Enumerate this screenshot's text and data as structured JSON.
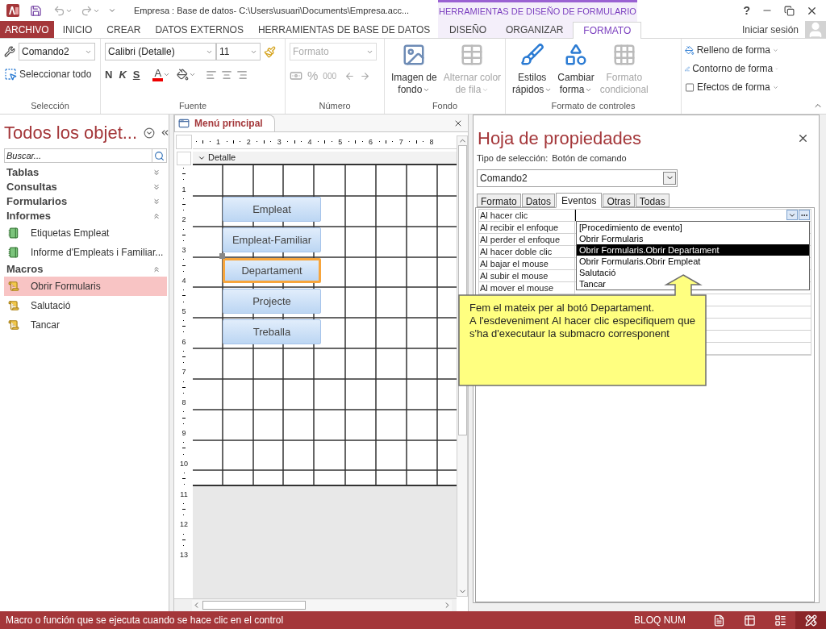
{
  "title_bar": {
    "title": "Empresa : Base de datos- C:\\Users\\usuari\\Documents\\Empresa.acc...",
    "contextual_group": "HERRAMIENTAS DE DISEÑO DE FORMULARIO",
    "help": "?"
  },
  "ribbon_tabs": [
    {
      "label": "ARCHIVO",
      "kind": "file",
      "selected": false
    },
    {
      "label": "INICIO",
      "kind": "normal",
      "selected": false
    },
    {
      "label": "CREAR",
      "kind": "normal",
      "selected": false
    },
    {
      "label": "DATOS EXTERNOS",
      "kind": "normal",
      "selected": false
    },
    {
      "label": "HERRAMIENTAS DE BASE DE DATOS",
      "kind": "normal",
      "selected": false
    },
    {
      "label": "DISEÑO",
      "kind": "contextual",
      "selected": false
    },
    {
      "label": "ORGANIZAR",
      "kind": "contextual",
      "selected": false
    },
    {
      "label": "FORMATO",
      "kind": "contextual",
      "selected": true
    }
  ],
  "account": {
    "sign_in": "Iniciar sesión"
  },
  "ribbon": {
    "seleccion": {
      "label": "Selección",
      "object_dropdown": "Comando2",
      "select_all": "Seleccionar todo"
    },
    "fuente": {
      "label": "Fuente",
      "font": "Calibri (Detalle)",
      "size": "11",
      "bold": "N",
      "italic": "K",
      "underline": "S",
      "font_color": "A"
    },
    "numero": {
      "label": "Número",
      "disabled": true,
      "format_dropdown": "Formato",
      "percent": "%",
      "thousands": "000"
    },
    "fondo": {
      "label": "Fondo",
      "buttons": [
        {
          "lines": [
            "Imagen de",
            "fondo"
          ],
          "kind": "picture",
          "disabled": false,
          "has_menu": true
        },
        {
          "lines": [
            "Alternar color",
            "de fila"
          ],
          "kind": "rows",
          "disabled": true,
          "has_menu": true
        }
      ]
    },
    "formato_controles": {
      "label": "Formato de controles",
      "large_buttons": [
        {
          "lines": [
            "Estilos",
            "rápidos"
          ],
          "kind": "styles",
          "disabled": false,
          "has_menu": true
        },
        {
          "lines": [
            "Cambiar",
            "forma"
          ],
          "kind": "shape",
          "disabled": false,
          "has_menu": true
        },
        {
          "lines": [
            "Formato",
            "condicional"
          ],
          "kind": "conditional",
          "disabled": true,
          "has_menu": false
        }
      ],
      "small_buttons": [
        {
          "label": "Relleno de forma",
          "kind": "fill"
        },
        {
          "label": "Contorno de forma",
          "kind": "outline"
        },
        {
          "label": "Efectos de forma",
          "kind": "effects"
        }
      ]
    }
  },
  "nav_pane": {
    "title": "Todos los objet...",
    "search_placeholder": "Buscar...",
    "groups": [
      {
        "label": "Tablas",
        "expanded": false
      },
      {
        "label": "Consultas",
        "expanded": false
      },
      {
        "label": "Formularios",
        "expanded": false
      },
      {
        "label": "Informes",
        "expanded": true,
        "children": [
          {
            "label": "Etiquetas Empleat",
            "kind": "report",
            "selected": false
          },
          {
            "label": "Informe d'Empleats i Familiar...",
            "kind": "report",
            "selected": false
          }
        ]
      },
      {
        "label": "Macros",
        "expanded": true,
        "children": [
          {
            "label": "Obrir Formularis",
            "kind": "macro",
            "selected": true
          },
          {
            "label": "Salutació",
            "kind": "macro",
            "selected": false
          },
          {
            "label": "Tancar",
            "kind": "macro",
            "selected": false
          }
        ]
      }
    ]
  },
  "document": {
    "tab": "Menú principal",
    "ruler_h": [
      "1",
      "2",
      "3",
      "4",
      "5",
      "6",
      "7",
      "8"
    ],
    "ruler_v": [
      "1",
      "2",
      "3",
      "4",
      "5",
      "6",
      "7",
      "8",
      "9",
      "10",
      "11",
      "12",
      "13"
    ],
    "section": "Detalle",
    "controls": [
      {
        "label": "Empleat",
        "selected": false
      },
      {
        "label": "Empleat-Familiar",
        "selected": false
      },
      {
        "label": "Departament",
        "selected": true
      },
      {
        "label": "Projecte",
        "selected": false
      },
      {
        "label": "Treballa",
        "selected": false
      }
    ]
  },
  "property_sheet": {
    "title": "Hoja de propiedades",
    "selection_type_label": "Tipo de selección:",
    "selection_type": "Botón de comando",
    "object": "Comando2",
    "tabs": [
      {
        "label": "Formato",
        "selected": false
      },
      {
        "label": "Datos",
        "selected": false
      },
      {
        "label": "Eventos",
        "selected": true
      },
      {
        "label": "Otras",
        "selected": false
      },
      {
        "label": "Todas",
        "selected": false
      }
    ],
    "rows": [
      {
        "label": "Al hacer clic",
        "selected": true
      },
      {
        "label": "Al recibir el enfoque",
        "selected": false
      },
      {
        "label": "Al perder el enfoque",
        "selected": false
      },
      {
        "label": "Al hacer doble clic",
        "selected": false
      },
      {
        "label": "Al bajar el mouse",
        "selected": false
      },
      {
        "label": "Al subir el mouse",
        "selected": false
      },
      {
        "label": "Al mover el mouse",
        "selected": false
      }
    ],
    "dropdown_options": [
      {
        "label": "[Procedimiento de evento]",
        "selected": false
      },
      {
        "label": "Obrir Formularis",
        "selected": false
      },
      {
        "label": "Obrir Formularis.Obrir Departament",
        "selected": true
      },
      {
        "label": "Obrir Formularis.Obrir Empleat",
        "selected": false
      },
      {
        "label": "Salutació",
        "selected": false
      },
      {
        "label": "Tancar",
        "selected": false
      }
    ]
  },
  "callout": {
    "paragraphs": [
      "Fem el mateix per al botó Departament.",
      "A l'esdeveniment Al hacer clic especifiquem que s'ha d'executaur la submacro corresponent"
    ]
  },
  "status_bar": {
    "message": "Macro o función que se ejecuta cuando se hace clic en el control",
    "indicator": "BLOQ NUM",
    "views": [
      {
        "kind": "form",
        "selected": false
      },
      {
        "kind": "datasheet",
        "selected": false
      },
      {
        "kind": "layout",
        "selected": false
      },
      {
        "kind": "design",
        "selected": true
      }
    ]
  }
}
